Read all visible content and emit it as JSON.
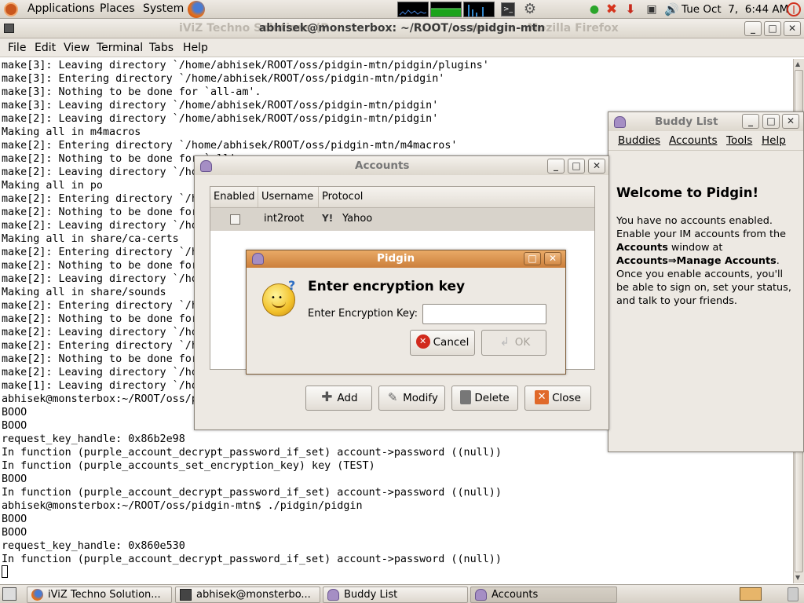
{
  "top_panel": {
    "menus": [
      "Applications",
      "Places",
      "System"
    ],
    "clock": "Tue Oct  7,  6:44 AM"
  },
  "terminal": {
    "window_title": "abhisek@monsterbox: ~/ROOT/oss/pidgin-mtn",
    "background_title_left": "iViZ Techno Solutions (P",
    "background_title_right": "ns.com - Mozilla Firefox",
    "menu": [
      "File",
      "Edit",
      "View",
      "Terminal",
      "Tabs",
      "Help"
    ],
    "lines": [
      "make[3]: Leaving directory `/home/abhisek/ROOT/oss/pidgin-mtn/pidgin/plugins'",
      "make[3]: Entering directory `/home/abhisek/ROOT/oss/pidgin-mtn/pidgin'",
      "make[3]: Nothing to be done for `all-am'.",
      "make[3]: Leaving directory `/home/abhisek/ROOT/oss/pidgin-mtn/pidgin'",
      "make[2]: Leaving directory `/home/abhisek/ROOT/oss/pidgin-mtn/pidgin'",
      "Making all in m4macros",
      "make[2]: Entering directory `/home/abhisek/ROOT/oss/pidgin-mtn/m4macros'",
      "make[2]: Nothing to be done for `all'.",
      "make[2]: Leaving directory `/home/abhisek/ROOT/oss/pidgin-mtn/m4macros'",
      "Making all in po",
      "make[2]: Entering directory `/h",
      "make[2]: Nothing to be done for",
      "make[2]: Leaving directory `/ho",
      "Making all in share/ca-certs",
      "make[2]: Entering directory `/h",
      "make[2]: Nothing to be done for",
      "make[2]: Leaving directory `/ho",
      "Making all in share/sounds",
      "make[2]: Entering directory `/h",
      "make[2]: Nothing to be done for",
      "make[2]: Leaving directory `/ho",
      "make[2]: Entering directory `/h",
      "make[2]: Nothing to be done for",
      "make[2]: Leaving directory `/ho",
      "make[1]: Leaving directory `/ho",
      "abhisek@monsterbox:~/ROOT/oss/p",
      "BOOO",
      "BOOO",
      "request_key_handle: 0x86b2e98",
      "In function (purple_account_decrypt_password_if_set) account->password ((null))",
      "In function (purple_accounts_set_encryption_key) key (TEST)",
      "BOOO",
      "In function (purple_account_decrypt_password_if_set) account->password ((null))",
      "abhisek@monsterbox:~/ROOT/oss/pidgin-mtn$ ./pidgin/pidgin",
      "BOOO",
      "BOOO",
      "request_key_handle: 0x860e530",
      "In function (purple_account_decrypt_password_if_set) account->password ((null))",
      ""
    ]
  },
  "buddy_list": {
    "title": "Buddy List",
    "menu": [
      "Buddies",
      "Accounts",
      "Tools",
      "Help"
    ],
    "welcome": "Welcome to Pidgin!",
    "body_1": "You have no accounts enabled.",
    "body_2": "Enable your IM accounts from the",
    "body_3_bold": "Accounts",
    "body_3_rest": " window at",
    "body_4": "Accounts⇒Manage Accounts",
    "body_4_end": ".",
    "body_5": "Once you enable accounts, you'll",
    "body_6": "be able to sign on, set your status,",
    "body_7": "and talk to your friends."
  },
  "accounts": {
    "title": "Accounts",
    "columns": [
      "Enabled",
      "Username",
      "Protocol"
    ],
    "rows": [
      {
        "enabled": false,
        "username": "int2root",
        "protocol": "Yahoo"
      }
    ],
    "buttons": {
      "add": "Add",
      "modify": "Modify",
      "delete": "Delete",
      "close": "Close"
    }
  },
  "dialog": {
    "title": "Pidgin",
    "heading": "Enter encryption key",
    "field_label": "Enter Encryption Key:",
    "field_value": "",
    "cancel": "Cancel",
    "ok": "OK"
  },
  "taskbar": {
    "items": [
      "iViZ Techno Solution...",
      "abhisek@monsterbo...",
      "Buddy List",
      "Accounts"
    ]
  },
  "colors": {
    "dialog_title": "#d9924e",
    "selected_row": "#d8d3cb",
    "terminal_bg": "#ffffff"
  }
}
